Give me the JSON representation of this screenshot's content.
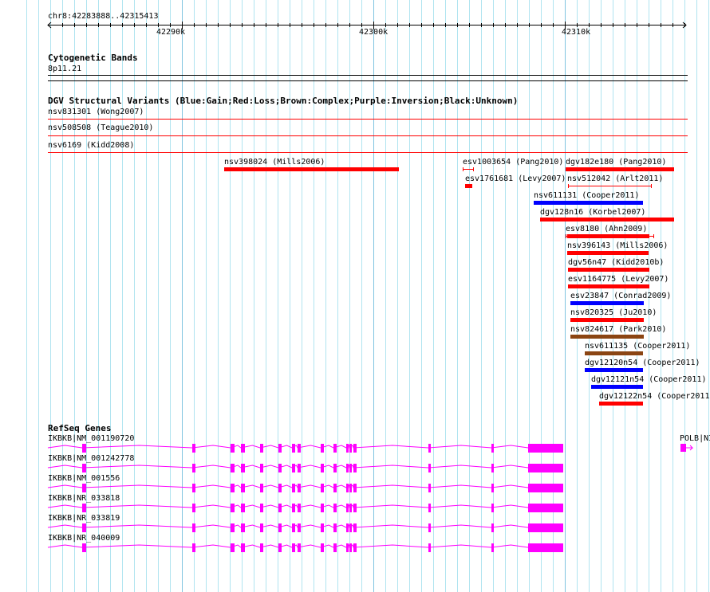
{
  "ruler": {
    "region": "chr8:42283888..42315413",
    "ticks": [
      "42290k",
      "42300k",
      "42310k"
    ]
  },
  "cytoband": {
    "title": "Cytogenetic Bands",
    "band": "8p11.21"
  },
  "dgv": {
    "title": "DGV Structural Variants (Blue:Gain;Red:Loss;Brown:Complex;Purple:Inversion;Black:Unknown)",
    "full_span": [
      "nsv831301 (Wong2007)",
      "nsv508508 (Teague2010)",
      "nsv6169 (Kidd2008)"
    ],
    "variants": [
      {
        "label": "nsv398024 (Mills2006)",
        "type": "Loss"
      },
      {
        "label": "esv1003654 (Pang2010)",
        "type": "Loss"
      },
      {
        "label": "dgv182e180 (Pang2010)",
        "type": "Loss"
      },
      {
        "label": "esv1761681 (Levy2007)",
        "type": "Loss"
      },
      {
        "label": "nsv512042 (Arlt2011)",
        "type": "Loss"
      },
      {
        "label": "nsv611131 (Cooper2011)",
        "type": "Gain"
      },
      {
        "label": "dgv128n16 (Korbel2007)",
        "type": "Loss"
      },
      {
        "label": "esv8180 (Ahn2009)",
        "type": "Loss"
      },
      {
        "label": "nsv396143 (Mills2006)",
        "type": "Loss"
      },
      {
        "label": "dgv56n47 (Kidd2010b)",
        "type": "Loss"
      },
      {
        "label": "esv1164775 (Levy2007)",
        "type": "Loss"
      },
      {
        "label": "esv23847 (Conrad2009)",
        "type": "Gain"
      },
      {
        "label": "nsv820325 (Ju2010)",
        "type": "Loss"
      },
      {
        "label": "nsv824617 (Park2010)",
        "type": "Complex"
      },
      {
        "label": "nsv611135 (Cooper2011)",
        "type": "Complex"
      },
      {
        "label": "dgv12120n54 (Cooper2011)",
        "type": "Gain"
      },
      {
        "label": "dgv12121n54 (Cooper2011)",
        "type": "Gain"
      },
      {
        "label": "dgv12122n54 (Cooper2011",
        "type": "Loss"
      }
    ]
  },
  "refseq": {
    "title": "RefSeq Genes",
    "transcripts": [
      "IKBKB|NM_001190720",
      "IKBKB|NM_001242778",
      "IKBKB|NM_001556",
      "IKBKB|NR_033818",
      "IKBKB|NR_033819",
      "IKBKB|NR_040009"
    ],
    "other_gene": "POLB|NI"
  },
  "colors": {
    "Gain": "#0000ff",
    "Loss": "#ff0000",
    "Complex": "#8b4513",
    "gene": "#ff00ff",
    "grid": "#b0e4f0",
    "grid_major": "#80c4e0",
    "track_line": "#ff0000"
  }
}
